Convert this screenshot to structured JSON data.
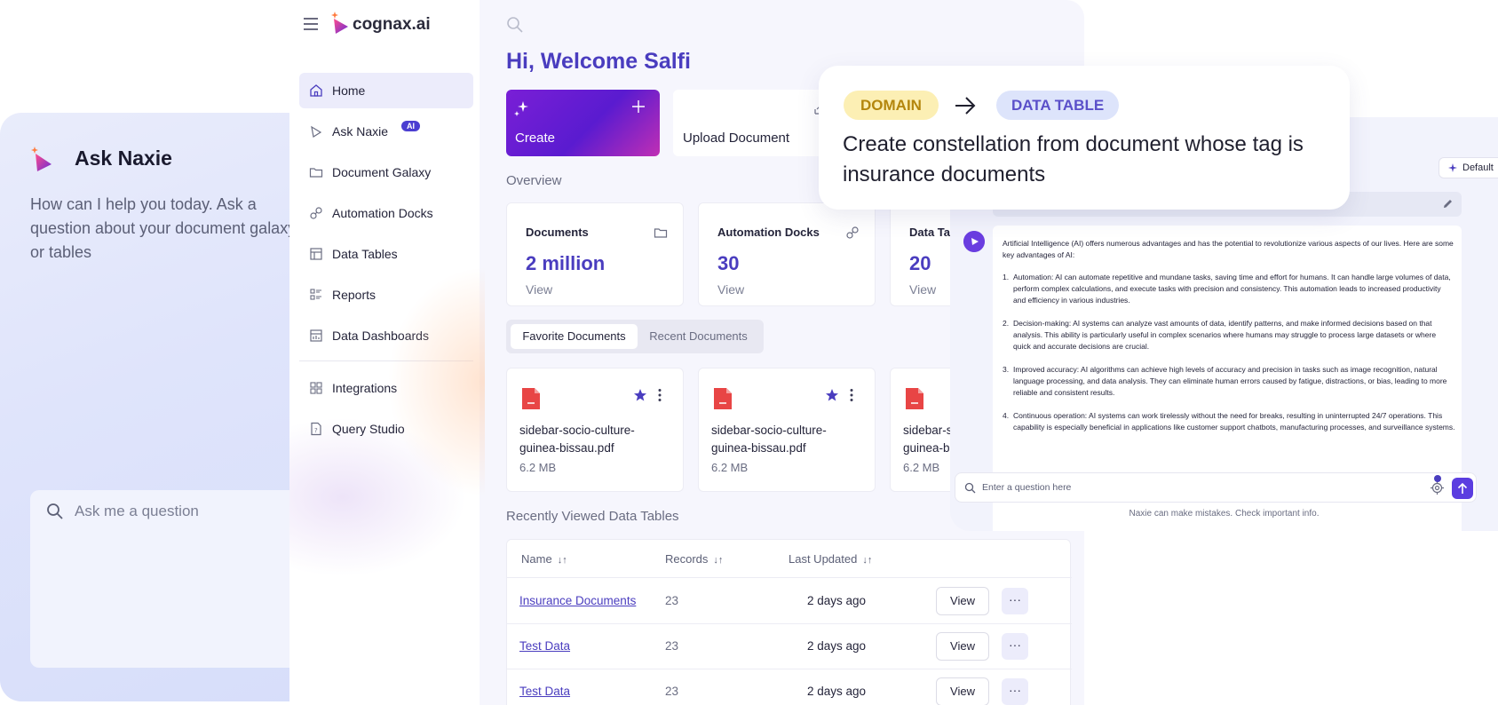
{
  "ask_panel": {
    "title": "Ask Naxie",
    "subtitle": "How can I help you today. Ask a question about your document galaxy or tables",
    "input_placeholder": "Ask me a question"
  },
  "app": {
    "brand": "cognax.ai",
    "nav": [
      {
        "label": "Home",
        "icon": "home-icon",
        "active": true
      },
      {
        "label": "Ask Naxie",
        "icon": "chat-icon",
        "badge": "AI"
      },
      {
        "label": "Document Galaxy",
        "icon": "folder-icon"
      },
      {
        "label": "Automation Docks",
        "icon": "link-icon"
      },
      {
        "label": "Data Tables",
        "icon": "table-icon"
      },
      {
        "label": "Reports",
        "icon": "report-icon"
      },
      {
        "label": "Data Dashboards",
        "icon": "dashboard-icon"
      },
      {
        "label": "Integrations",
        "icon": "grid-icon"
      },
      {
        "label": "Query Studio",
        "icon": "query-icon"
      }
    ],
    "greeting": "Hi, Welcome Salfi",
    "create_label": "Create",
    "upload_label": "Upload Document",
    "overview_label": "Overview",
    "stats": [
      {
        "title": "Documents",
        "value": "2 million",
        "link": "View"
      },
      {
        "title": "Automation Docks",
        "value": "30",
        "link": "View"
      },
      {
        "title": "Data Tables",
        "value": "20",
        "link": "View"
      }
    ],
    "tabs": {
      "favorite": "Favorite Documents",
      "recent": "Recent Documents"
    },
    "documents": [
      {
        "name": "sidebar-socio-culture-guinea-bissau.pdf",
        "size": "6.2 MB"
      },
      {
        "name": "sidebar-socio-culture-guinea-bissau.pdf",
        "size": "6.2 MB"
      },
      {
        "name": "sidebar-socio-culture-guinea-bissau.pdf",
        "size": "6.2 MB"
      }
    ],
    "data_tables_label": "Recently Viewed Data Tables",
    "table": {
      "headers": {
        "name": "Name",
        "records": "Records",
        "updated": "Last Updated"
      },
      "sort_glyph": "↓↑",
      "view_label": "View",
      "more_label": "···",
      "rows": [
        {
          "name": "Insurance Documents",
          "records": "23",
          "updated": "2 days ago"
        },
        {
          "name": "Test Data",
          "records": "23",
          "updated": "2 days ago"
        },
        {
          "name": "Test Data",
          "records": "23",
          "updated": "2 days ago"
        }
      ]
    }
  },
  "overlay": {
    "chip_from": "DOMAIN",
    "chip_to": "DATA TABLE",
    "text": "Create constellation from document whose tag is insurance documents"
  },
  "chat": {
    "model_button": "Default",
    "answer_intro": "Artificial Intelligence (AI) offers numerous advantages and has the potential to revolutionize various aspects of our lives. Here are some key advantages of AI:",
    "answer_points": [
      {
        "num": "1.",
        "text": "Automation: AI can automate repetitive and mundane tasks, saving time and effort for humans. It can handle large volumes of data, perform complex calculations, and execute tasks with precision and consistency. This automation leads to increased productivity and efficiency in various industries."
      },
      {
        "num": "2.",
        "text": "Decision-making: AI systems can analyze vast amounts of data, identify patterns, and make informed decisions based on that analysis. This ability is particularly useful in complex scenarios where humans may struggle to process large datasets or where quick and accurate decisions are crucial."
      },
      {
        "num": "3.",
        "text": "Improved accuracy: AI algorithms can achieve high levels of accuracy and precision in tasks such as image recognition, natural language processing, and data analysis. They can eliminate human errors caused by fatigue, distractions, or bias, leading to more reliable and consistent results."
      },
      {
        "num": "4.",
        "text": "Continuous operation: AI systems can work tirelessly without the need for breaks, resulting in uninterrupted 24/7 operations. This capability is especially beneficial in applications like customer support chatbots, manufacturing processes, and surveillance systems."
      }
    ],
    "input_placeholder": "Enter a question here",
    "disclaimer": "Naxie can make mistakes. Check important info."
  },
  "colors": {
    "brand": "#4a3dbf",
    "accent_pink": "#e0358e",
    "file_red": "#e84545"
  }
}
